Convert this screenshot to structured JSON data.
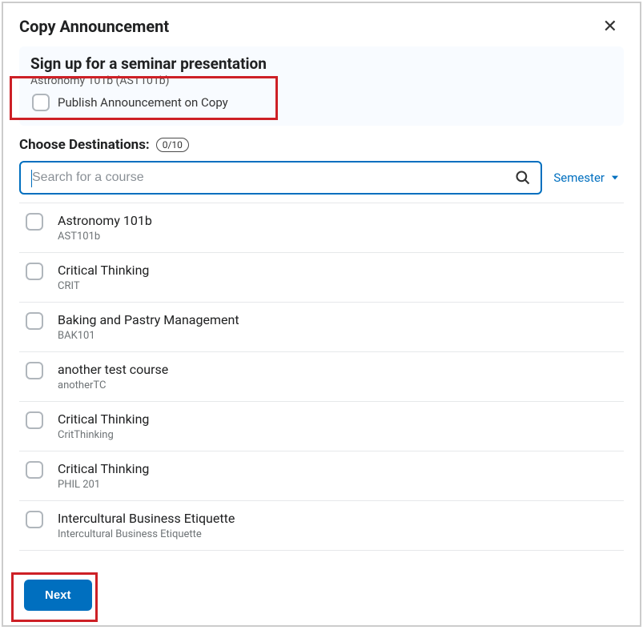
{
  "dialog": {
    "title": "Copy Announcement"
  },
  "announcement": {
    "title": "Sign up for a seminar presentation",
    "subtitle": "Astronomy 101b (AST101b)",
    "publish_label": "Publish Announcement on Copy"
  },
  "destinations": {
    "label": "Choose Destinations:",
    "count": "0/10",
    "search_placeholder": "Search for a course",
    "filter_label": "Semester",
    "courses": [
      {
        "name": "Astronomy 101b",
        "code": "AST101b"
      },
      {
        "name": "Critical Thinking",
        "code": "CRIT"
      },
      {
        "name": "Baking and Pastry Management",
        "code": "BAK101"
      },
      {
        "name": "another test course",
        "code": "anotherTC"
      },
      {
        "name": "Critical Thinking",
        "code": "CritThinking"
      },
      {
        "name": "Critical Thinking",
        "code": "PHIL 201"
      },
      {
        "name": "Intercultural Business Etiquette",
        "code": "Intercultural Business Etiquette"
      }
    ]
  },
  "footer": {
    "next_label": "Next"
  }
}
